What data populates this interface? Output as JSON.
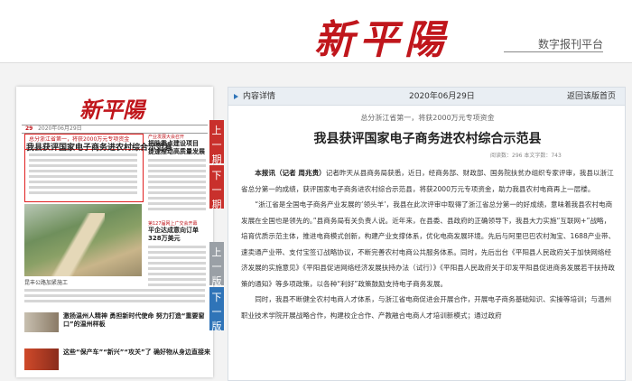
{
  "header": {
    "logo": "新平陽",
    "platform": "数字报刊平台"
  },
  "paper": {
    "logo": "新平陽",
    "meta": {
      "issue_no": "29",
      "date": "2020年06月29日"
    },
    "headline_sub": "总分浙江省第一，将获2000万元专项资金",
    "headline": "我县获评国家电子商务进农村综合示范县",
    "side_sub": "产业发展大会召开",
    "side_title": "把脉重点建设项目 提速推动高质量发展",
    "photo_caption": "昆丰公路加紧施工",
    "side2_sub": "第127届网上广交会开幕",
    "side2_title": "平企达成意向订单328万美元",
    "story2": "激扬温州人精神 勇担新时代使命 努力打造“重要窗口”的温州样板",
    "story3": "这些“保产车”“新兴”“攻关”了 确好物从身边直接来"
  },
  "nav": {
    "prev_issue": "上一期",
    "next_issue": "下一期",
    "prev_page": "上一版",
    "next_page": "下一版"
  },
  "article_panel": {
    "label": "内容详情",
    "date": "2020年06月29日",
    "back": "返回该版首页",
    "subtitle": "总分浙江省第一，将获2000万元专项资金",
    "title": "我县获评国家电子商务进农村综合示范县",
    "stats": "阅读数：296    本文字数：743",
    "byline": "本报讯（记者 周兆贵）",
    "para1": "记者昨天从县商务局获悉，近日，经商务部、财政部、国务院扶贫办组织专家评审，我县以浙江省总分第一的成绩，获评国家电子商务进农村综合示范县，将获2000万元专项资金，助力我县农村电商再上一层楼。",
    "para2": "“浙江省是全国电子商务产业发展的‘领头羊’，我县在此次评审中取得了浙江省总分第一的好成绩，意味着我县农村电商发展在全国也是领先的。”县商务局有关负责人说。近年来，在县委、县政府的正确领导下，我县大力实施“互联网+”战略，培育优质示范主体，推进电商模式创新，构建产业支撑体系，优化电商发展环境。先后与阿里巴巴农村淘宝、1688产业带、速卖通产业带、支付宝签订战略协议，不断完善农村电商公共服务体系。同时，先后出台《平阳县人民政府关于加快网络经济发展的实施意见》《平阳县促进网络经济发展扶持办法（试行）》《平阳县人民政府关于印发平阳县促进商务发展若干扶持政策的通知》等多项政策，以各种“利好”政策鼓励支持电子商务发展。",
    "para3": "同时，我县不断健全农村电商人才体系，与浙江省电商促进会开展合作，开展电子商务基础知识、实操等培训；与温州职业技术学院开展战略合作，构建校企合作、产教融合电商人才培训新模式；通过政府"
  }
}
